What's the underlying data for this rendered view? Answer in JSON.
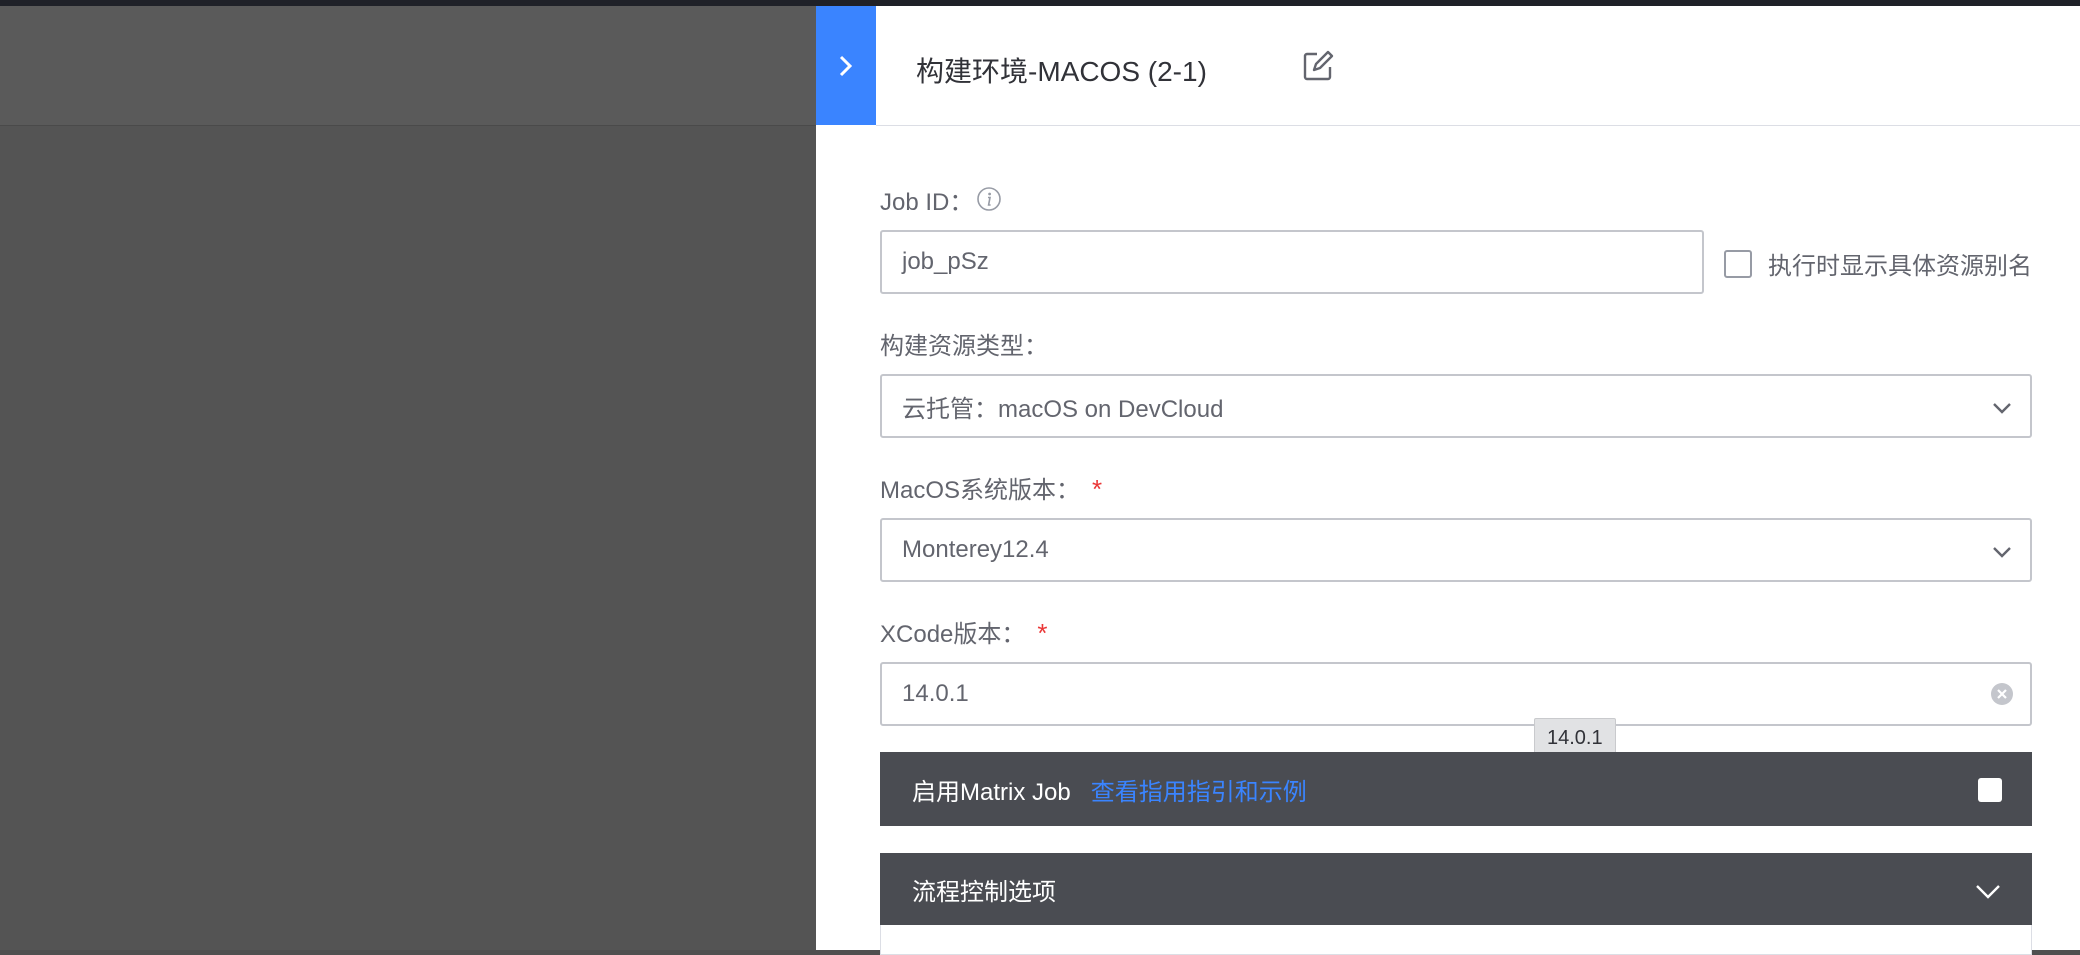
{
  "panel": {
    "title": "构建环境-MACOS (2-1)"
  },
  "form": {
    "job_id": {
      "label": "Job ID：",
      "value": "job_pSz",
      "show_alias_label": "执行时显示具体资源别名"
    },
    "resource_type": {
      "label": "构建资源类型：",
      "value": "云托管：macOS on DevCloud"
    },
    "macos_version": {
      "label": "MacOS系统版本：",
      "required_mark": "*",
      "value": "Monterey12.4"
    },
    "xcode_version": {
      "label": "XCode版本：",
      "required_mark": "*",
      "value": "14.0.1",
      "tooltip": "14.0.1"
    }
  },
  "matrix_job": {
    "label": "启用Matrix Job",
    "link": "查看指用指引和示例"
  },
  "flow_control": {
    "label": "流程控制选项"
  },
  "colors": {
    "accent": "#3a84ff",
    "required": "#ea3636",
    "section_bar": "#4a4c52"
  }
}
